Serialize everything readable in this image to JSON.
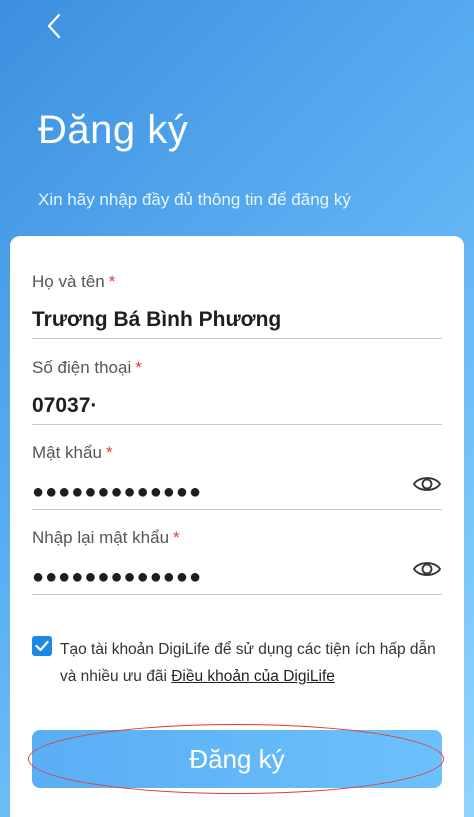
{
  "header": {
    "back_icon": "chevron-left-icon",
    "title": "Đăng ký",
    "subtitle": "Xin hãy nhập đầy đủ thông tin để đăng ký"
  },
  "form": {
    "full_name": {
      "label": "Họ và tên",
      "required_mark": "*",
      "value": "Trương Bá Bình Phương"
    },
    "phone": {
      "label": "Số điện thoại",
      "required_mark": "*",
      "value": "07037·"
    },
    "password": {
      "label": "Mật khẩu",
      "required_mark": "*",
      "value": "●●●●●●●●●●●●●",
      "toggle_icon": "eye-icon"
    },
    "confirm_password": {
      "label": "Nhập lại mật khẩu",
      "required_mark": "*",
      "value": "●●●●●●●●●●●●●",
      "toggle_icon": "eye-icon"
    }
  },
  "terms": {
    "checked": true,
    "text": "Tạo tài khoản DigiLife để sử dụng các tiện ích hấp dẫn và nhiều ưu đãi ",
    "link_text": "Điều khoản của DigiLife"
  },
  "submit": {
    "label": "Đăng ký"
  },
  "colors": {
    "accent": "#1e88e5",
    "button": "#59aef5",
    "required": "#e53935",
    "highlight": "#e53935"
  }
}
